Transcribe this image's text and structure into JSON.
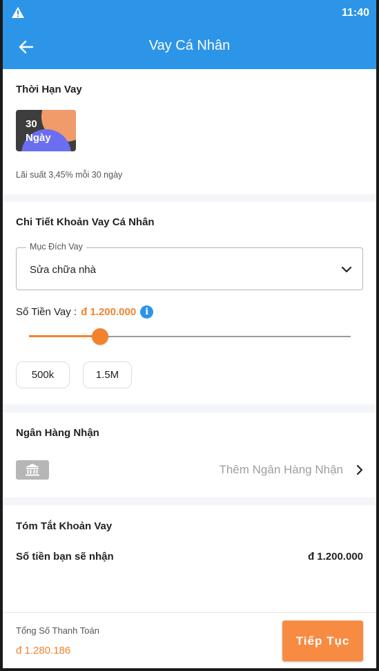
{
  "status_bar": {
    "time": "11:40"
  },
  "header": {
    "title": "Vay Cá Nhân"
  },
  "loan_term": {
    "title": "Thời Hạn Vay",
    "option_number": "30",
    "option_unit": "Ngày",
    "rate_note": "Lãi suất 3,45% mỗi 30 ngày"
  },
  "loan_details": {
    "title": "Chi Tiết Khoản Vay Cá Nhân",
    "purpose_label": "Mục Đích Vay",
    "purpose_value": "Sửa chữa nhà",
    "amount_label": "Số Tiền Vay :",
    "amount_value": "đ 1.200.000",
    "slider_fraction": 0.22,
    "quick_amounts": [
      "500k",
      "1.5M"
    ]
  },
  "bank": {
    "title": "Ngân Hàng Nhận",
    "add_label": "Thêm Ngân Hàng Nhận"
  },
  "summary": {
    "title": "Tóm Tắt Khoản Vay",
    "receive_label": "Số tiền bạn sẽ nhận",
    "receive_value": "đ 1.200.000"
  },
  "footer": {
    "total_label": "Tổng Số Thanh Toán",
    "total_value": "đ 1.280.186",
    "continue_label": "Tiếp Tục"
  },
  "colors": {
    "primary": "#2d95e8",
    "accent": "#f2832c",
    "button": "#f88b42"
  },
  "icons": [
    "warning-icon",
    "back-arrow-icon",
    "chevron-down-icon",
    "info-icon",
    "bank-icon",
    "chevron-right-icon"
  ]
}
